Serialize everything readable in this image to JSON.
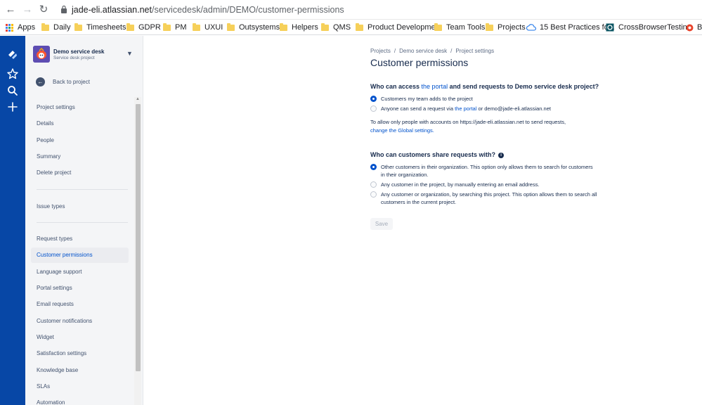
{
  "browser": {
    "url_host": "jade-eli.atlassian.net",
    "url_path": "/servicedesk/admin/DEMO/customer-permissions",
    "bookmarks": [
      {
        "label": "Apps",
        "icon": "apps-grid-icon"
      },
      {
        "label": "Daily",
        "icon": "folder-icon"
      },
      {
        "label": "Timesheets",
        "icon": "folder-icon"
      },
      {
        "label": "GDPR",
        "icon": "folder-icon"
      },
      {
        "label": "PM",
        "icon": "folder-icon"
      },
      {
        "label": "UXUI",
        "icon": "folder-icon"
      },
      {
        "label": "Outsystems",
        "icon": "folder-icon"
      },
      {
        "label": "Helpers",
        "icon": "folder-icon"
      },
      {
        "label": "QMS",
        "icon": "folder-icon"
      },
      {
        "label": "Product Developme...",
        "icon": "folder-icon"
      },
      {
        "label": "Team Tools",
        "icon": "folder-icon"
      },
      {
        "label": "Projects",
        "icon": "folder-icon"
      },
      {
        "label": "15 Best Practices fo...",
        "icon": "cloud-icon"
      },
      {
        "label": "CrossBrowserTestin...",
        "icon": "crossbrowser-icon"
      },
      {
        "label": "Bo",
        "icon": "record-icon"
      }
    ]
  },
  "sidebar": {
    "project_name": "Demo service desk",
    "project_type": "Service desk project",
    "back_label": "Back to project",
    "heading": "Project settings",
    "items": [
      {
        "label": "Details"
      },
      {
        "label": "People"
      },
      {
        "label": "Summary"
      },
      {
        "label": "Delete project"
      },
      {
        "label": "Issue types"
      },
      {
        "label": "Request types"
      },
      {
        "label": "Customer permissions",
        "active": true
      },
      {
        "label": "Language support"
      },
      {
        "label": "Portal settings"
      },
      {
        "label": "Email requests"
      },
      {
        "label": "Customer notifications"
      },
      {
        "label": "Widget"
      },
      {
        "label": "Satisfaction settings"
      },
      {
        "label": "Knowledge base"
      },
      {
        "label": "SLAs"
      },
      {
        "label": "Automation"
      }
    ]
  },
  "main": {
    "breadcrumbs": [
      "Projects",
      "/",
      "Demo service desk",
      "/",
      "Project settings"
    ],
    "title": "Customer permissions",
    "access": {
      "q_prefix": "Who can access",
      "q_link": "the portal",
      "q_suffix": "and send requests to Demo service desk project?",
      "options": [
        {
          "text": "Customers my team adds to the project",
          "selected": true
        },
        {
          "pre": "Anyone can send a request via",
          "link": "the portal",
          "post": "or demo@jade-eli.atlassian.net",
          "selected": false
        }
      ],
      "note_text": "To allow only people with accounts on https://jade-eli.atlassian.net to send requests,",
      "note_link": "change the Global settings."
    },
    "share": {
      "question": "Who can customers share requests with?",
      "options": [
        {
          "text": "Other customers in their organization. This option only allows them to search for customers in their organization.",
          "selected": true
        },
        {
          "text": "Any customer in the project, by manually entering an email address.",
          "selected": false
        },
        {
          "text": "Any customer or organization, by searching this project. This option allows them to search all customers in the current project.",
          "selected": false
        }
      ]
    },
    "save_label": "Save"
  },
  "colors": {
    "global_nav": "#0747a6",
    "link": "#0052cc",
    "text": "#172b4d",
    "sidebar_bg": "#f4f5f7"
  }
}
